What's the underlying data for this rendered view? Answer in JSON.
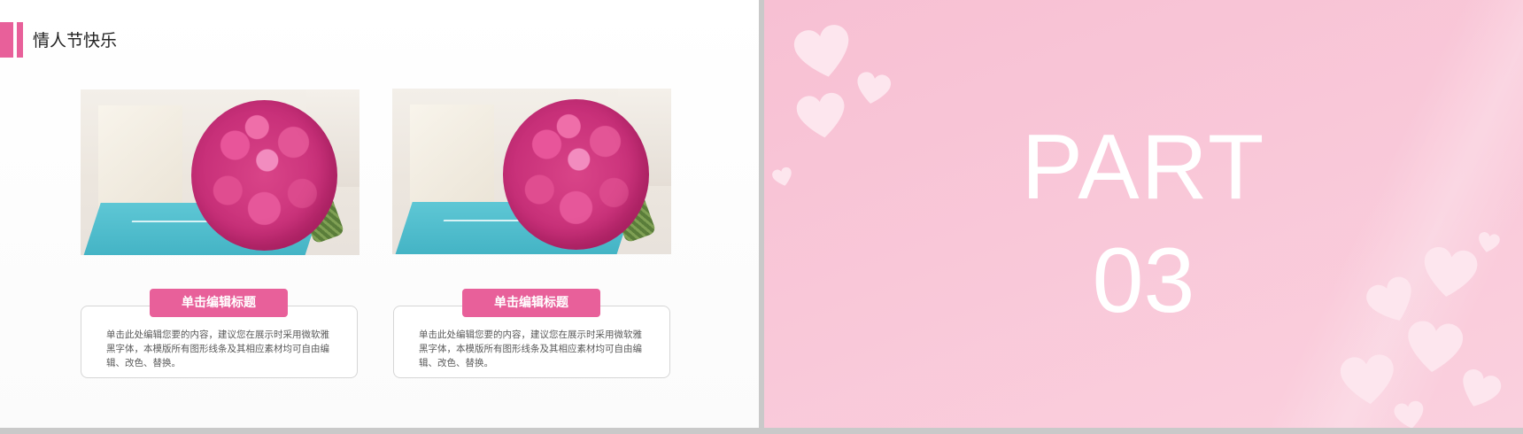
{
  "left_slide": {
    "title": "情人节快乐",
    "accent_color": "#e8609a",
    "cards": [
      {
        "photo_icon": "rose-bouquet-photo",
        "heading": "单击编辑标题",
        "body": "单击此处编辑您要的内容，建议您在展示时采用微软雅黑字体，本模版所有图形线条及其相应素材均可自由编辑、改色、替换。"
      },
      {
        "photo_icon": "rose-bouquet-photo",
        "heading": "单击编辑标题",
        "body": "单击此处编辑您要的内容，建议您在展示时采用微软雅黑字体，本模版所有图形线条及其相应素材均可自由编辑、改色、替换。"
      }
    ]
  },
  "right_slide": {
    "part_label": "PART",
    "part_number": "03",
    "background_color": "#f8c6d6",
    "decoration_icon": "heart-icon"
  }
}
